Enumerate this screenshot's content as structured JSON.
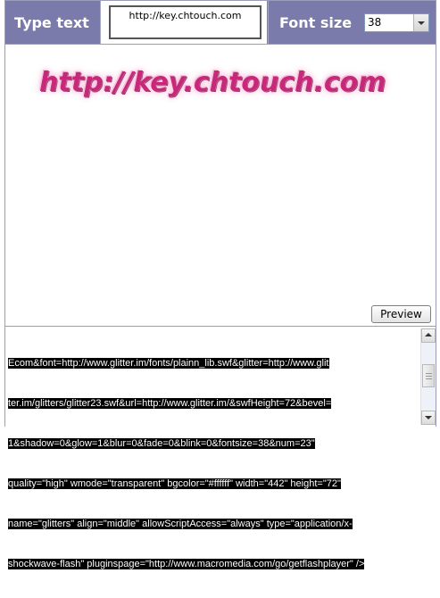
{
  "header": {
    "type_text_label": "Type text",
    "text_value": "http://key.chtouch.com",
    "font_size_label": "Font size",
    "font_size_value": "38"
  },
  "preview": {
    "glitter_text": "http://key.chtouch.com",
    "button_label": "Preview"
  },
  "embed_code": {
    "lines": [
      "Ecom&font=http://www.glitter.im/fonts/plainn_lib.swf&glitter=http://www.glit",
      "ter.im/glitters/glitter23.swf&url=http://www.glitter.im/&swfHeight=72&bevel=",
      "1&shadow=0&glow=1&blur=0&fade=0&blink=0&fontsize=38&num=23\"",
      "quality=\"high\" wmode=\"transparent\" bgcolor=\"#ffffff\" width=\"442\" height=\"72\"",
      "name=\"glitters\" align=\"middle\" allowScriptAccess=\"always\" type=\"application/x-",
      "shockwave-flash\" pluginspage=\"http://www.macromedia.com/go/getflashplayer\" />"
    ]
  },
  "colors": {
    "header_bg": "#7b7bab",
    "glitter_pink": "#c8287a",
    "code_highlight": "#000000"
  }
}
